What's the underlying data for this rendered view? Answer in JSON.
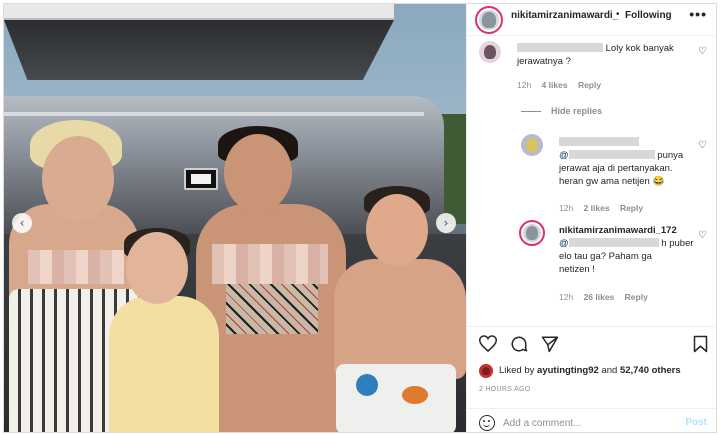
{
  "post": {
    "username": "nikitamirzanimawardi_",
    "separator": "•",
    "follow_status": "Following",
    "more_label": "•••"
  },
  "photo": {
    "prev_label": "‹",
    "next_label": "›"
  },
  "comments": [
    {
      "text": "Loly kok banyak jerawatnya ?",
      "time": "12h",
      "likes": "4 likes",
      "reply_label": "Reply"
    }
  ],
  "hide_replies_label": "Hide replies",
  "replies": [
    {
      "text_line1_end": "punya",
      "text_line2": "jerawat aja di pertanyakan.",
      "text_line3": "heran gw ama netijen 😂",
      "time": "12h",
      "likes": "2 likes",
      "reply_label": "Reply"
    },
    {
      "username": "nikitamirzanimawardi_172",
      "text_line1_end": "h puber",
      "text_line2": "elo tau ga? Paham ga",
      "text_line3": "netizen !",
      "time": "12h",
      "likes": "26 likes",
      "reply_label": "Reply"
    }
  ],
  "likes": {
    "prefix": "Liked by ",
    "liker": "ayutingting92",
    "middle": " and ",
    "count": "52,740 others"
  },
  "timestamp": "2 HOURS AGO",
  "add_comment": {
    "placeholder": "Add a comment...",
    "post_label": "Post"
  },
  "colors": {
    "accent_blue": "#0095f6",
    "post_button_disabled": "#b2dffc",
    "story_ring": "#e1306c"
  },
  "icons": [
    "heart-icon",
    "comment-icon",
    "share-icon",
    "bookmark-icon",
    "emoji-icon",
    "more-options-icon"
  ]
}
